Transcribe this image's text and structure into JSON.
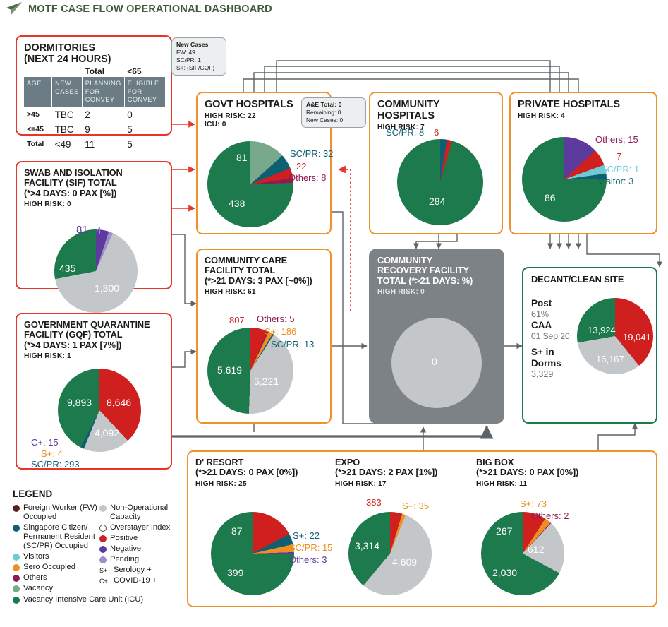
{
  "header": {
    "title": "MOTF CASE FLOW OPERATIONAL DASHBOARD",
    "logo_icon": "paper-plane-icon"
  },
  "colors": {
    "fw_occupied": "#5c1f1f",
    "scpr_occupied": "#0f5f72",
    "visitors": "#6ecbd4",
    "sero_occupied": "#ef8f21",
    "others": "#8e1b53",
    "vacancy": "#79a98c",
    "vacancy_icu": "#1d7a4c",
    "non_operational": "#c3c7c9",
    "overstayer": "#ffffff",
    "positive": "#cf1f1f",
    "negative": "#5c3a9e",
    "pending": "#9b8ec9",
    "red_border": "#e8352a",
    "orange_border": "#f0922b",
    "green_border": "#1d7a4c",
    "grey_panel": "#7c8285",
    "title_green": "#3f5c3a"
  },
  "dormitories": {
    "title_line1": "DORMITORIES",
    "title_line2": "(NEXT 24 HOURS)",
    "span_headers": [
      "Total",
      "<65"
    ],
    "columns": [
      "AGE",
      "NEW CASES",
      "PLANNING FOR CONVEY",
      "ELIGIBLE FOR CONVEY"
    ],
    "rows": [
      {
        "age": ">45",
        "new_cases": "TBC",
        "planning": "2",
        "eligible": "0"
      },
      {
        "age": "<=45",
        "new_cases": "TBC",
        "planning": "9",
        "eligible": "5"
      },
      {
        "age": "Total",
        "new_cases": "<49",
        "planning": "11",
        "eligible": "5"
      }
    ]
  },
  "new_cases_callout": {
    "title": "New Cases",
    "lines": [
      "FW: 49",
      "SC/PR: 1",
      "S+: (SIF/GQF)"
    ]
  },
  "ae_callout": {
    "lines": [
      "A&E Total: 0",
      "Remaining: 0",
      "New Cases: 0"
    ]
  },
  "sif": {
    "title_line1": "SWAB AND ISOLATION",
    "title_line2": "FACILITY (SIF) TOTAL",
    "title_line3": "(*>4 DAYS: 0 PAX [%])",
    "high_risk": "HIGH RISK: 0",
    "chart_data": {
      "type": "pie",
      "title": "Swab and Isolation Facility (SIF) Total",
      "labels": [
        "Vacancy ICU",
        "Negative",
        "Pending",
        "Non-Operational Capacity"
      ],
      "values": [
        435,
        81,
        4,
        1300
      ],
      "colors": [
        "#1d7a4c",
        "#5c3a9e",
        "#9b8ec9",
        "#c3c7c9"
      ],
      "legend": "inline-labels"
    }
  },
  "gqf": {
    "title_line1": "GOVERNMENT QUARANTINE",
    "title_line2": "FACILITY (GQF) TOTAL",
    "title_line3": "(*>4 DAYS: 1 PAX [7%])",
    "high_risk": "HIGH RISK: 1",
    "annotations": [
      {
        "text": "C+: 15",
        "color": "#5c3a9e"
      },
      {
        "text": "S+: 4",
        "color": "#ef8f21"
      },
      {
        "text": "SC/PR: 293",
        "color": "#0f5f72"
      }
    ],
    "chart_data": {
      "type": "pie",
      "title": "Government Quarantine Facility (GQF) Total",
      "labels": [
        "Positive",
        "Non-Operational Capacity",
        "SC/PR Occupied",
        "Vacancy ICU"
      ],
      "values": [
        8646,
        4092,
        293,
        9893
      ],
      "colors": [
        "#cf1f1f",
        "#c3c7c9",
        "#0f5f72",
        "#1d7a4c"
      ],
      "extra": {
        "C+": 15,
        "S+": 4,
        "SC/PR": 293
      }
    }
  },
  "govt_hospitals": {
    "title": "GOVT HOSPITALS",
    "high_risk": "HIGH RISK: 22",
    "icu": "ICU: 0",
    "annotations": [
      {
        "text": "SC/PR: 32",
        "color": "#0f5f72"
      },
      {
        "text": "22",
        "color": "#cf1f1f"
      },
      {
        "text": "Others: 8",
        "color": "#8e1b53"
      }
    ],
    "chart_data": {
      "type": "pie",
      "title": "Govt Hospitals",
      "labels": [
        "Vacancy",
        "SC/PR Occupied",
        "Positive",
        "Others",
        "Vacancy ICU"
      ],
      "values": [
        81,
        32,
        22,
        8,
        438
      ],
      "colors": [
        "#79a98c",
        "#0f5f72",
        "#cf1f1f",
        "#8e1b53",
        "#1d7a4c"
      ]
    }
  },
  "community_hospitals": {
    "title": "COMMUNITY HOSPITALS",
    "high_risk": "HIGH RISK: 7",
    "annotations": [
      {
        "text": "SC/PR: 8",
        "color": "#0f5f72"
      },
      {
        "text": "6",
        "color": "#cf1f1f"
      }
    ],
    "chart_data": {
      "type": "pie",
      "title": "Community Hospitals",
      "labels": [
        "SC/PR Occupied",
        "Positive",
        "Vacancy ICU"
      ],
      "values": [
        8,
        6,
        284
      ],
      "colors": [
        "#0f5f72",
        "#cf1f1f",
        "#1d7a4c"
      ]
    }
  },
  "private_hospitals": {
    "title": "PRIVATE HOSPITALS",
    "high_risk": "HIGH RISK: 4",
    "annotations": [
      {
        "text": "Others: 15",
        "color": "#8e1b53"
      },
      {
        "text": "7",
        "color": "#cf1f1f"
      },
      {
        "text": "SC/PR: 1",
        "color": "#6ecbd4"
      },
      {
        "text": "Visitor: 3",
        "color": "#0f5f72"
      }
    ],
    "chart_data": {
      "type": "pie",
      "title": "Private Hospitals",
      "labels": [
        "Others",
        "Positive",
        "Visitors",
        "SC/PR Occupied",
        "Vacancy ICU"
      ],
      "values": [
        15,
        7,
        3,
        1,
        86
      ],
      "colors": [
        "#5c3a9e",
        "#cf1f1f",
        "#6ecbd4",
        "#0f5f72",
        "#1d7a4c"
      ]
    }
  },
  "community_care": {
    "title_line1": "COMMUNITY CARE",
    "title_line2": "FACILITY TOTAL",
    "title_line3": "(*>21 DAYS: 3 PAX [~0%])",
    "high_risk": "HIGH RISK: 61",
    "annotations": [
      {
        "text": "807",
        "color": "#cf1f1f"
      },
      {
        "text": "Others: 5",
        "color": "#8e1b53"
      },
      {
        "text": "S+: 186",
        "color": "#ef8f21"
      },
      {
        "text": "SC/PR: 13",
        "color": "#0f5f72"
      }
    ],
    "chart_data": {
      "type": "pie",
      "title": "Community Care Facility Total",
      "labels": [
        "Positive",
        "Others",
        "Sero Occupied",
        "SC/PR Occupied",
        "Non-Operational Capacity",
        "Vacancy ICU"
      ],
      "values": [
        807,
        5,
        186,
        13,
        5221,
        5619
      ],
      "colors": [
        "#cf1f1f",
        "#8e1b53",
        "#ef8f21",
        "#0f5f72",
        "#c3c7c9",
        "#1d7a4c"
      ]
    }
  },
  "community_recovery": {
    "title_line1": "COMMUNITY",
    "title_line2": "RECOVERY FACILITY",
    "title_line3": "TOTAL (*>21 DAYS: %)",
    "high_risk": "HIGH RISK: 0",
    "chart_data": {
      "type": "pie",
      "title": "Community Recovery Facility Total",
      "labels": [
        "Non-Operational Capacity"
      ],
      "values": [
        0
      ],
      "center_label": "0",
      "colors": [
        "#c3c7c9"
      ]
    }
  },
  "decant": {
    "title": "DECANT/CLEAN SITE",
    "stats": [
      {
        "label": "Post",
        "value": "61%"
      },
      {
        "label": "CAA",
        "value": "01 Sep 20"
      },
      {
        "label": "S+ in Dorms",
        "value": "3,329"
      }
    ],
    "chart_data": {
      "type": "pie",
      "title": "Decant/Clean Site",
      "labels": [
        "Positive",
        "Non-Operational Capacity",
        "Vacancy ICU"
      ],
      "values": [
        19041,
        16167,
        13924
      ],
      "colors": [
        "#cf1f1f",
        "#c3c7c9",
        "#1d7a4c"
      ]
    }
  },
  "facilities": [
    {
      "title_line1": "D' RESORT",
      "title_line2": "(*>21 DAYS: 0 PAX [0%])",
      "high_risk": "HIGH RISK: 25",
      "annotations": [
        {
          "text": "87",
          "color": "#cf1f1f"
        },
        {
          "text": "S+: 22",
          "color": "#0f5f72"
        },
        {
          "text": "SC/PR: 15",
          "color": "#ef8f21"
        },
        {
          "text": "Others: 3",
          "color": "#5c3a9e"
        }
      ],
      "chart_data": {
        "type": "pie",
        "title": "D' Resort",
        "labels": [
          "Positive",
          "SC/PR Occupied",
          "Sero Occupied",
          "Others",
          "Vacancy ICU"
        ],
        "values": [
          87,
          22,
          15,
          3,
          399
        ],
        "colors": [
          "#cf1f1f",
          "#0f5f72",
          "#ef8f21",
          "#5c3a9e",
          "#1d7a4c"
        ]
      }
    },
    {
      "title_line1": "EXPO",
      "title_line2": "(*>21 DAYS: 2 PAX [1%])",
      "high_risk": "HIGH RISK: 17",
      "annotations": [
        {
          "text": "383",
          "color": "#cf1f1f"
        },
        {
          "text": "S+: 35",
          "color": "#ef8f21"
        }
      ],
      "chart_data": {
        "type": "pie",
        "title": "Expo",
        "labels": [
          "Positive",
          "Sero Occupied",
          "Non-Operational Capacity",
          "Vacancy ICU"
        ],
        "values": [
          383,
          35,
          4609,
          3314
        ],
        "colors": [
          "#cf1f1f",
          "#ef8f21",
          "#c3c7c9",
          "#1d7a4c"
        ]
      }
    },
    {
      "title_line1": "BIG BOX",
      "title_line2": "(*>21 DAYS: 0 PAX [0%])",
      "high_risk": "HIGH RISK: 11",
      "annotations": [
        {
          "text": "267",
          "color": "#cf1f1f"
        },
        {
          "text": "S+: 73",
          "color": "#ef8f21"
        },
        {
          "text": "Others: 2",
          "color": "#8e1b53"
        }
      ],
      "chart_data": {
        "type": "pie",
        "title": "Big Box",
        "labels": [
          "Positive",
          "Sero Occupied",
          "Others",
          "Non-Operational Capacity",
          "Vacancy ICU"
        ],
        "values": [
          267,
          73,
          2,
          612,
          2030
        ],
        "colors": [
          "#cf1f1f",
          "#ef8f21",
          "#8e1b53",
          "#c3c7c9",
          "#1d7a4c"
        ]
      }
    }
  ],
  "legend": {
    "title": "LEGEND",
    "left": [
      {
        "label": "Foreign Worker (FW) Occupied",
        "color": "#5c1f1f",
        "style": "dot"
      },
      {
        "label": "Singapore Citizen/ Permanent Resident (SC/PR) Occupied",
        "color": "#0f5f72",
        "style": "dot"
      },
      {
        "label": "Visitors",
        "color": "#6ecbd4",
        "style": "dot"
      },
      {
        "label": "Sero Occupied",
        "color": "#ef8f21",
        "style": "dot"
      },
      {
        "label": "Others",
        "color": "#8e1b53",
        "style": "dot"
      },
      {
        "label": "Vacancy",
        "color": "#79a98c",
        "style": "dot"
      },
      {
        "label": "Vacancy Intensive Care Unit (ICU)",
        "color": "#1d7a4c",
        "style": "dot"
      }
    ],
    "right": [
      {
        "label": "Non-Operational Capacity",
        "color": "#c3c7c9",
        "style": "dot"
      },
      {
        "label": "Overstayer Index",
        "color": "#ffffff",
        "style": "hollow"
      },
      {
        "label": "Positive",
        "color": "#cf1f1f",
        "style": "dot"
      },
      {
        "label": "Negative",
        "color": "#5c3a9e",
        "style": "dot"
      },
      {
        "label": "Pending",
        "color": "#9b8ec9",
        "style": "dot"
      },
      {
        "label": "Serology +",
        "symbol": "S+",
        "style": "symbol"
      },
      {
        "label": "COVID-19 +",
        "symbol": "C+",
        "style": "symbol"
      }
    ]
  }
}
